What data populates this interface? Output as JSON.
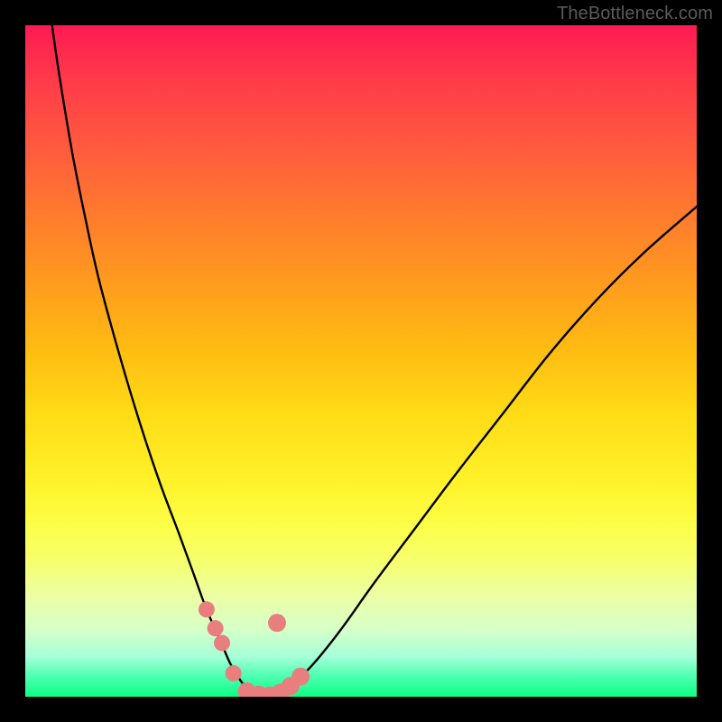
{
  "attribution": "TheBottleneck.com",
  "chart_data": {
    "type": "line",
    "title": "",
    "xlabel": "",
    "ylabel": "",
    "xlim": [
      0,
      100
    ],
    "ylim": [
      0,
      100
    ],
    "grid": false,
    "legend": false,
    "background_gradient": {
      "top_color": "#ff1a52",
      "bottom_color": "#0cff85",
      "note": "vertical red→yellow→green gradient indicating bottleneck severity"
    },
    "series": [
      {
        "name": "left-curve",
        "x": [
          4,
          5,
          7,
          9,
          11,
          14,
          17,
          20,
          23,
          25,
          27,
          29,
          30.5,
          32,
          33.5
        ],
        "y": [
          100,
          93,
          81,
          71,
          62,
          51,
          41,
          32,
          24,
          18.5,
          13,
          8.5,
          5,
          2.5,
          0.5
        ]
      },
      {
        "name": "right-curve",
        "x": [
          38,
          40,
          43,
          47,
          52,
          58,
          64,
          71,
          78,
          85,
          92,
          100
        ],
        "y": [
          0.5,
          2,
          5,
          10,
          17,
          25,
          33,
          42,
          51,
          59,
          66,
          73
        ]
      }
    ],
    "markers": {
      "name": "highlighted-points",
      "color": "#e97e7e",
      "points": [
        {
          "x": 27.0,
          "y": 13.0,
          "r": 9
        },
        {
          "x": 28.3,
          "y": 10.2,
          "r": 9
        },
        {
          "x": 29.3,
          "y": 8.0,
          "r": 9
        },
        {
          "x": 31.0,
          "y": 3.5,
          "r": 9
        },
        {
          "x": 33.0,
          "y": 0.8,
          "r": 10
        },
        {
          "x": 34.8,
          "y": 0.3,
          "r": 10
        },
        {
          "x": 36.5,
          "y": 0.2,
          "r": 10
        },
        {
          "x": 38.0,
          "y": 0.6,
          "r": 10
        },
        {
          "x": 39.5,
          "y": 1.6,
          "r": 10
        },
        {
          "x": 41.0,
          "y": 3.0,
          "r": 10
        },
        {
          "x": 37.5,
          "y": 11.0,
          "r": 10
        }
      ]
    }
  }
}
